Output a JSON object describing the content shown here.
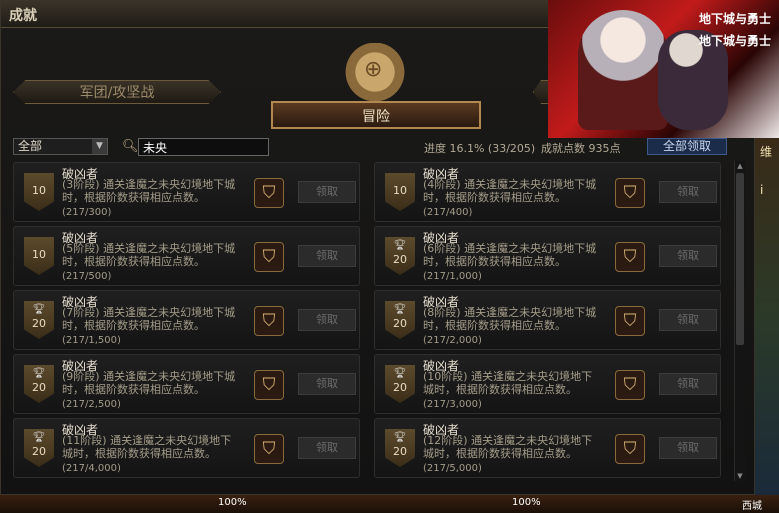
{
  "window": {
    "title": "成就"
  },
  "banner": {
    "logo_top": "地下城与勇士",
    "logo_bottom": "地下城与勇士"
  },
  "tabs": {
    "left": "军团/攻坚战",
    "active": "冒险"
  },
  "filter": {
    "selected": "全部",
    "search_value": "未央"
  },
  "stats": {
    "progress": "进度 16.1% (33/205)",
    "points": "成就点数 935点"
  },
  "buttons": {
    "claim_all": "全部领取"
  },
  "cards": [
    {
      "title": "破凶者",
      "desc": "(3阶段) 通关逢魔之未央幻境地下城时，根据阶数获得相应点数。",
      "count": "(217/300)",
      "badge": "10",
      "trophy": false,
      "claim": "领取"
    },
    {
      "title": "破凶者",
      "desc": "(4阶段) 通关逢魔之未央幻境地下城时，根据阶数获得相应点数。",
      "count": "(217/400)",
      "badge": "10",
      "trophy": false,
      "claim": "领取"
    },
    {
      "title": "破凶者",
      "desc": "(5阶段) 通关逢魔之未央幻境地下城时，根据阶数获得相应点数。",
      "count": "(217/500)",
      "badge": "10",
      "trophy": false,
      "claim": "领取"
    },
    {
      "title": "破凶者",
      "desc": "(6阶段) 通关逢魔之未央幻境地下城时，根据阶数获得相应点数。",
      "count": "(217/1,000)",
      "badge": "20",
      "trophy": true,
      "claim": "领取"
    },
    {
      "title": "破凶者",
      "desc": "(7阶段) 通关逢魔之未央幻境地下城时，根据阶数获得相应点数。",
      "count": "(217/1,500)",
      "badge": "20",
      "trophy": true,
      "claim": "领取"
    },
    {
      "title": "破凶者",
      "desc": "(8阶段) 通关逢魔之未央幻境地下城时，根据阶数获得相应点数。",
      "count": "(217/2,000)",
      "badge": "20",
      "trophy": true,
      "claim": "领取"
    },
    {
      "title": "破凶者",
      "desc": "(9阶段) 通关逢魔之未央幻境地下城时，根据阶数获得相应点数。",
      "count": "(217/2,500)",
      "badge": "20",
      "trophy": true,
      "claim": "领取"
    },
    {
      "title": "破凶者",
      "desc": "(10阶段) 通关逢魔之未央幻境地下城时，根据阶数获得相应点数。",
      "count": "(217/3,000)",
      "badge": "20",
      "trophy": true,
      "claim": "领取"
    },
    {
      "title": "破凶者",
      "desc": "(11阶段) 通关逢魔之未央幻境地下城时，根据阶数获得相应点数。",
      "count": "(217/4,000)",
      "badge": "20",
      "trophy": true,
      "claim": "领取"
    },
    {
      "title": "破凶者",
      "desc": "(12阶段) 通关逢魔之未央幻境地下城时，根据阶数获得相应点数。",
      "count": "(217/5,000)",
      "badge": "20",
      "trophy": true,
      "claim": "领取"
    }
  ],
  "icons": {
    "reward": "emblem-icon",
    "trophy": "trophy-icon",
    "search": "search-icon"
  },
  "side": {
    "text1": "维",
    "text2": "i"
  },
  "hud": {
    "hp": "100%",
    "mp": "100%",
    "town": "西城"
  }
}
